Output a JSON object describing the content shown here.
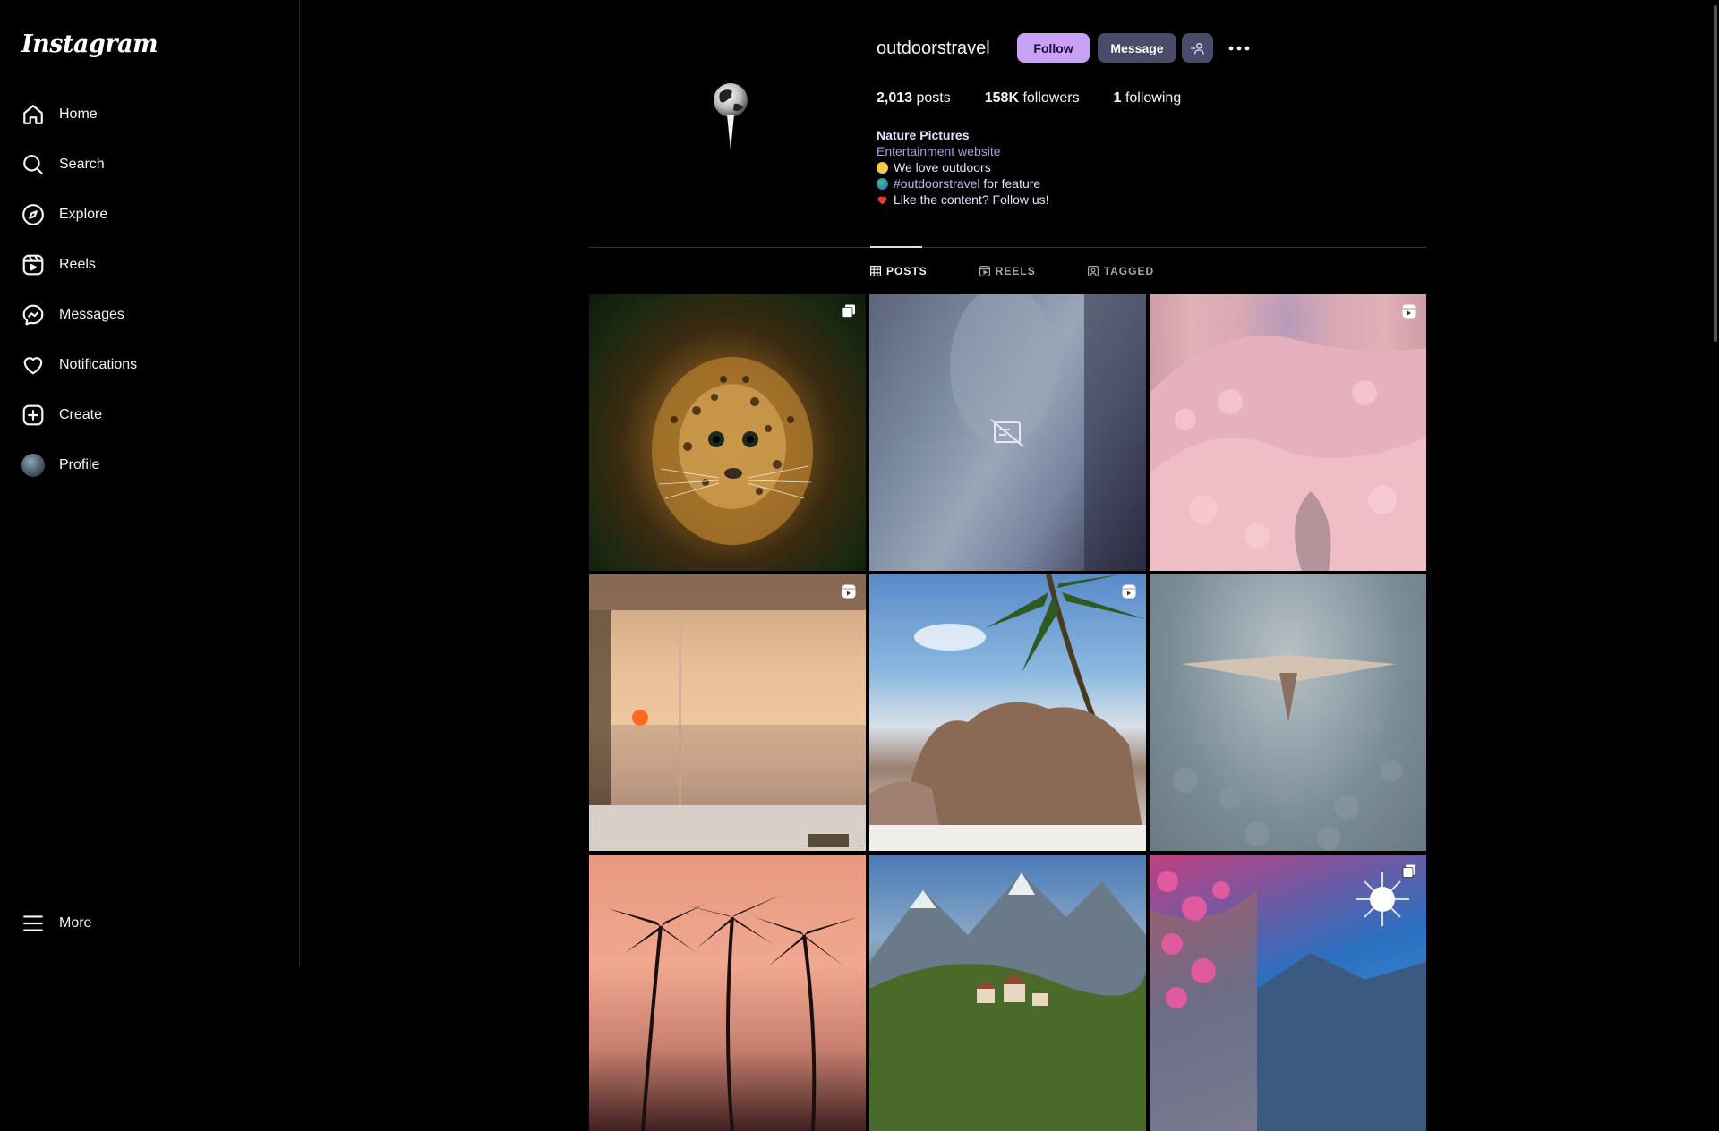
{
  "brand": {
    "logo": "Instagram"
  },
  "sidebar": {
    "items": [
      {
        "label": "Home",
        "icon": "home-icon"
      },
      {
        "label": "Search",
        "icon": "search-icon"
      },
      {
        "label": "Explore",
        "icon": "compass-icon"
      },
      {
        "label": "Reels",
        "icon": "reels-icon"
      },
      {
        "label": "Messages",
        "icon": "messenger-icon"
      },
      {
        "label": "Notifications",
        "icon": "heart-icon"
      },
      {
        "label": "Create",
        "icon": "plus-square-icon"
      },
      {
        "label": "Profile",
        "icon": "avatar"
      }
    ],
    "more": {
      "label": "More",
      "icon": "hamburger-icon"
    }
  },
  "profile": {
    "username": "outdoorstravel",
    "follow_label": "Follow",
    "message_label": "Message",
    "stats": {
      "posts_count": "2,013",
      "posts_label": "posts",
      "followers_count": "158K",
      "followers_label": "followers",
      "following_count": "1",
      "following_label": "following"
    },
    "bio": {
      "name": "Nature Pictures",
      "category": "Entertainment website",
      "line1": "We love outdoors",
      "line2_tag": "#outdoorstravel",
      "line2_rest": "for feature",
      "line3": "Like the content? Follow us!"
    }
  },
  "tabs": [
    {
      "label": "POSTS",
      "icon": "grid-icon",
      "active": true
    },
    {
      "label": "REELS",
      "icon": "reels-icon",
      "active": false
    },
    {
      "label": "TAGGED",
      "icon": "tag-icon",
      "active": false
    }
  ],
  "posts": [
    {
      "subject": "leopard",
      "badge": "carousel-icon"
    },
    {
      "subject": "unavailable",
      "badge": ""
    },
    {
      "subject": "pink forest",
      "badge": "reel-icon"
    },
    {
      "subject": "sunset window",
      "badge": "reel-icon"
    },
    {
      "subject": "beach rocks",
      "badge": "reel-icon"
    },
    {
      "subject": "bird over water",
      "badge": ""
    },
    {
      "subject": "palm trees sunset",
      "badge": ""
    },
    {
      "subject": "mountain village",
      "badge": ""
    },
    {
      "subject": "flowers coast",
      "badge": "carousel-icon"
    }
  ],
  "colors": {
    "accent_follow": "#c9a2f5",
    "button_secondary": "#4a4a6a",
    "bio_link": "#c0b4ff"
  }
}
